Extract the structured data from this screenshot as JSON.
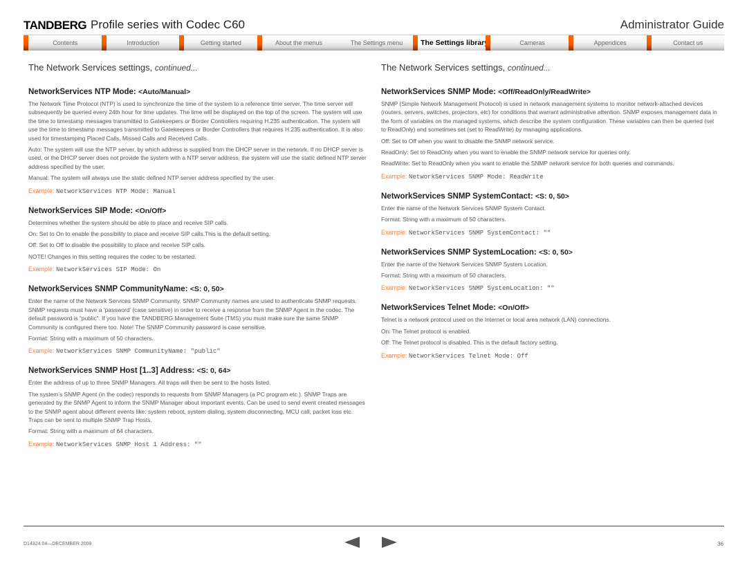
{
  "header": {
    "logo": "TANDBERG",
    "doc_title": "Profile series with Codec C60",
    "guide_title": "Administrator Guide"
  },
  "nav": {
    "tabs": [
      {
        "label": "Contents",
        "active": false
      },
      {
        "label": "Introduction",
        "active": false
      },
      {
        "label": "Getting started",
        "active": false
      },
      {
        "label": "About the menus",
        "active": false
      },
      {
        "label": "The Settings menu",
        "active": false
      },
      {
        "label": "The Settings library",
        "active": true
      },
      {
        "label": "Cameras",
        "active": false
      },
      {
        "label": "Appendices",
        "active": false
      },
      {
        "label": "Contact us",
        "active": false
      }
    ]
  },
  "left": {
    "heading": "The Network Services settings, ",
    "heading_italic": "continued...",
    "settings": [
      {
        "title": "NetworkServices NTP Mode: ",
        "range": "<Auto/Manual>",
        "paragraphs": [
          "The Network Time Protocol (NTP) is used to synchronize the time of the system to a reference time server. The time server will subsequently be queried every 24th hour for time updates. The time will be displayed on the top of the screen. The system will use the time to timestamp messages transmitted to Gatekeepers or Border Controllers requiring H.235 authentication. The system will use the time to timestamp messages transmitted to Gatekeepers or Border Controllers that requires H.235 authentication. It is also used for timestamping Placed Calls, Missed Calls and Received Calls.",
          "Auto: The system will use the NTP server, by which address is supplied from the DHCP server in the network. If no DHCP server is used, or the DHCP server does not provide the system with a NTP server address, the system will use the static defined NTP server address specified by the user.",
          "Manual: The system will always use the static defined NTP server address specified by the user."
        ],
        "example_label": "Example:",
        "example_code": "NetworkServices NTP Mode: Manual"
      },
      {
        "title": "NetworkServices SIP Mode: ",
        "range": "<On/Off>",
        "paragraphs": [
          "Determines whether the system should be able to place and receive SIP calls.",
          "On: Set to On to enable the possibility to place and receive SIP calls.This is the default setting.",
          "Off: Set to Off to disable the possibility to place and receive SIP calls.",
          "NOTE! Changes in this setting requires the codec to be restarted."
        ],
        "example_label": "Example:",
        "example_code": "NetworkServices SIP Mode: On"
      },
      {
        "title": "NetworkServices SNMP CommunityName: ",
        "range": "<S: 0, 50>",
        "paragraphs": [
          "Enter the name of the Network Services SNMP Community. SNMP Community names are used to authenticate SNMP requests. SNMP requests must have a ‘password’ (case sensitive) in order to receive a response from the SNMP Agent in the codec. The default password is “public”. If you have the TANDBERG Management Suite (TMS) you must make sure the same SNMP Community is configured there too. Note! The SNMP Community password is case sensitive.",
          "Format: String with a maximum of 50 characters."
        ],
        "example_label": "Example:",
        "example_code": "NetworkServices SNMP CommunityName: \"public\""
      },
      {
        "title": "NetworkServices SNMP Host [1..3] Address: ",
        "range": "<S: 0, 64>",
        "paragraphs": [
          "Enter the address of up to three SNMP Managers. All traps will then be sent to the hosts listed.",
          "The system’s SNMP Agent (in the codec) responds to requests from SNMP Managers (a PC program etc.). SNMP Traps are generated by the SNMP Agent to inform the SNMP Manager about important events. Can be used to send event created messages to the SNMP agent about different events like: system reboot, system dialing, system disconnecting, MCU call, packet loss etc. Traps can be sent to multiple SNMP Trap Hosts.",
          "Format: String with a maximum of 64 characters."
        ],
        "example_label": "Example:",
        "example_code": "NetworkServices SNMP Host 1 Address: \"\""
      }
    ]
  },
  "right": {
    "heading": "The Network Services settings, ",
    "heading_italic": "continued...",
    "settings": [
      {
        "title": "NetworkServices SNMP Mode: ",
        "range": "<Off/ReadOnly/ReadWrite>",
        "paragraphs": [
          "SNMP (Simple Network Management Protocol) is used in network management systems to monitor network-attached devices (routers, servers, switches, projectors, etc) for conditions that warrant administrative attention. SNMP exposes management data in the form of variables on the managed systems, which describe the system configuration. These variables can then be queried (set to ReadOnly) and sometimes set (set to ReadWrite) by managing applications.",
          "Off: Set to Off when you want to disable the SNMP network service.",
          "ReadOnly: Set to ReadOnly when you want to enable the SNMP network service for queries only.",
          "ReadWrite: Set to ReadOnly when you want to enable the SNMP network service for both queries and commands."
        ],
        "example_label": "Example:",
        "example_code": "NetworkServices SNMP Mode: ReadWrite"
      },
      {
        "title": "NetworkServices SNMP SystemContact: ",
        "range": "<S: 0, 50>",
        "paragraphs": [
          "Enter the name of the Network Services SNMP System Contact.",
          "Format: String with a maximum of 50 characters."
        ],
        "example_label": "Example:",
        "example_code": "NetworkServices SNMP SystemContact: \"\""
      },
      {
        "title": "NetworkServices SNMP SystemLocation: ",
        "range": "<S: 0, 50>",
        "paragraphs": [
          "Enter the name of the Network Services SNMP System Location.",
          "Format: String with a maximum of 50 characters."
        ],
        "example_label": "Example:",
        "example_code": "NetworkServices SNMP SystemLocation: \"\""
      },
      {
        "title": "NetworkServices Telnet Mode: ",
        "range": "<On/Off>",
        "paragraphs": [
          "Telnet is a network protocol used on the Internet or local area network (LAN) connections.",
          "On: The Telnet protocol is enabled.",
          "Off: The Telnet protocol is disabled. This is the default factory setting."
        ],
        "example_label": "Example:",
        "example_code": "NetworkServices Telnet Mode: Off"
      }
    ]
  },
  "footer": {
    "doc_id": "D14324.04—DECEMBER 2009",
    "page_number": "36",
    "prev_icon": "left-triangle-icon",
    "next_icon": "right-triangle-icon"
  }
}
